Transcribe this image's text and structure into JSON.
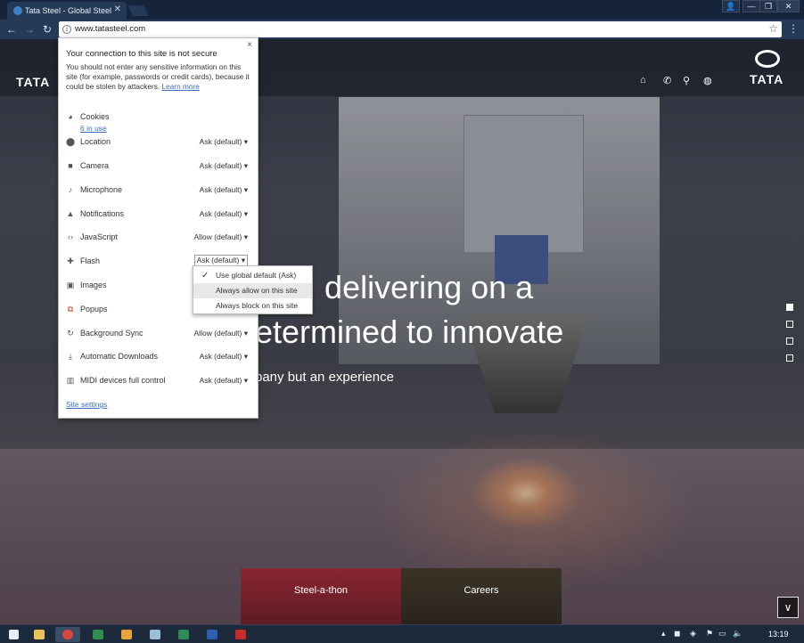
{
  "browser": {
    "tab_title": "Tata Steel - Global Steel",
    "tab_close": "✕",
    "url": "www.tatasteel.com",
    "info_glyph": "i",
    "window_controls": [
      "👤",
      "—",
      "❐",
      "✕"
    ]
  },
  "site": {
    "logo_left": "TATA",
    "logo_right": "TATA",
    "nav_icons": [
      "home-icon",
      "phone-icon",
      "search-icon",
      "globe-icon"
    ],
    "hero_line1": "ues, delivering on a",
    "hero_line2": "etermined to innovate",
    "hero_line3": "pany but an experience",
    "cards": [
      "Steel-a-thon",
      "Careers"
    ],
    "slide_indicator": {
      "count": 4,
      "active_index": 0
    }
  },
  "popup": {
    "close": "×",
    "heading": "Your connection to this site is not secure",
    "description": "You should not enter any sensitive information on this site (for example, passwords or credit cards), because it could be stolen by attackers.",
    "learn_more": "Learn more",
    "cookies_label": "Cookies",
    "cookies_sub": "6 in use",
    "permissions": [
      {
        "label": "Location",
        "value": "Ask (default) ▾",
        "icon": "location-icon"
      },
      {
        "label": "Camera",
        "value": "Ask (default) ▾",
        "icon": "camera-icon"
      },
      {
        "label": "Microphone",
        "value": "Ask (default) ▾",
        "icon": "microphone-icon"
      },
      {
        "label": "Notifications",
        "value": "Ask (default) ▾",
        "icon": "bell-icon"
      },
      {
        "label": "JavaScript",
        "value": "Allow (default) ▾",
        "icon": "code-icon"
      },
      {
        "label": "Flash",
        "value": "Ask (default) ▾",
        "icon": "puzzle-icon"
      },
      {
        "label": "Images",
        "value": "",
        "icon": "image-icon"
      },
      {
        "label": "Popups",
        "value": "",
        "icon": "popup-icon"
      },
      {
        "label": "Background Sync",
        "value": "Allow (default) ▾",
        "icon": "sync-icon"
      },
      {
        "label": "Automatic Downloads",
        "value": "Ask (default) ▾",
        "icon": "download-icon"
      },
      {
        "label": "MIDI devices full control",
        "value": "Ask (default) ▾",
        "icon": "midi-icon"
      }
    ],
    "site_settings": "Site settings",
    "flash_dropdown": {
      "options": [
        "Use global default (Ask)",
        "Always allow on this site",
        "Always block on this site"
      ],
      "checked_index": 0,
      "hover_index": 1
    }
  },
  "taskbar": {
    "clock": "13:19"
  }
}
